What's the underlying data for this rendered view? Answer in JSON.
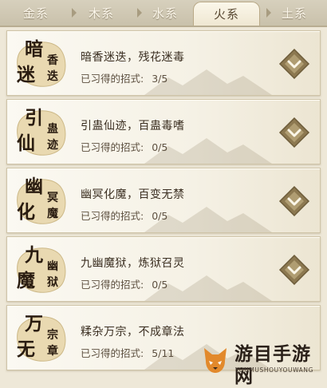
{
  "tabs": [
    {
      "label": "金系",
      "active": false
    },
    {
      "label": "木系",
      "active": false
    },
    {
      "label": "水系",
      "active": false
    },
    {
      "label": "火系",
      "active": true
    },
    {
      "label": "土系",
      "active": false
    }
  ],
  "progress_label": "已习得的招式:",
  "skills": [
    {
      "emblem_big": [
        "暗",
        "迷"
      ],
      "emblem_small": [
        "香",
        "迭"
      ],
      "title": "暗香迷迭，残花迷毒",
      "learned": "3/5"
    },
    {
      "emblem_big": [
        "引",
        "仙"
      ],
      "emblem_small": [
        "蛊",
        "迹"
      ],
      "title": "引蛊仙迹，百蛊毒嗜",
      "learned": "0/5"
    },
    {
      "emblem_big": [
        "幽",
        "化"
      ],
      "emblem_small": [
        "冥",
        "魔"
      ],
      "title": "幽冥化魔，百变无禁",
      "learned": "0/5"
    },
    {
      "emblem_big": [
        "九",
        "魔"
      ],
      "emblem_small": [
        "幽",
        "狱"
      ],
      "title": "九幽魔狱，炼狱召灵",
      "learned": "0/5"
    },
    {
      "emblem_big": [
        "万",
        "无"
      ],
      "emblem_small": [
        "宗",
        "章"
      ],
      "title": "糅杂万宗，不成章法",
      "learned": "5/11"
    }
  ],
  "watermark": {
    "text": "游目手游网",
    "sub": "YOUMUSHOUYOUWANG"
  },
  "colors": {
    "accent": "#8a6a32",
    "badge": "#e6d7b2",
    "button": "#8c7850"
  }
}
